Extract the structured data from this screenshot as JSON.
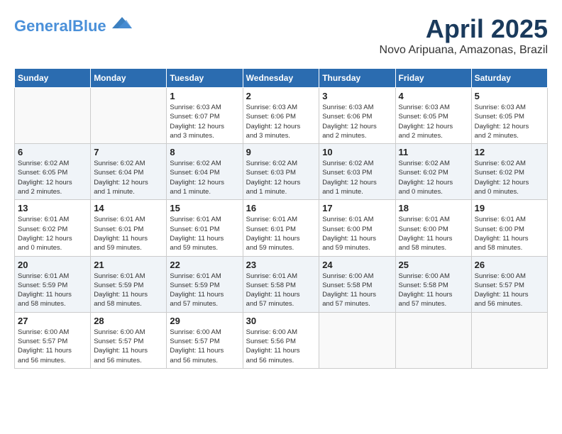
{
  "header": {
    "logo_line1": "General",
    "logo_line2": "Blue",
    "month": "April 2025",
    "location": "Novo Aripuana, Amazonas, Brazil"
  },
  "weekdays": [
    "Sunday",
    "Monday",
    "Tuesday",
    "Wednesday",
    "Thursday",
    "Friday",
    "Saturday"
  ],
  "weeks": [
    [
      {
        "day": "",
        "detail": ""
      },
      {
        "day": "",
        "detail": ""
      },
      {
        "day": "1",
        "detail": "Sunrise: 6:03 AM\nSunset: 6:07 PM\nDaylight: 12 hours\nand 3 minutes."
      },
      {
        "day": "2",
        "detail": "Sunrise: 6:03 AM\nSunset: 6:06 PM\nDaylight: 12 hours\nand 3 minutes."
      },
      {
        "day": "3",
        "detail": "Sunrise: 6:03 AM\nSunset: 6:06 PM\nDaylight: 12 hours\nand 2 minutes."
      },
      {
        "day": "4",
        "detail": "Sunrise: 6:03 AM\nSunset: 6:05 PM\nDaylight: 12 hours\nand 2 minutes."
      },
      {
        "day": "5",
        "detail": "Sunrise: 6:03 AM\nSunset: 6:05 PM\nDaylight: 12 hours\nand 2 minutes."
      }
    ],
    [
      {
        "day": "6",
        "detail": "Sunrise: 6:02 AM\nSunset: 6:05 PM\nDaylight: 12 hours\nand 2 minutes."
      },
      {
        "day": "7",
        "detail": "Sunrise: 6:02 AM\nSunset: 6:04 PM\nDaylight: 12 hours\nand 1 minute."
      },
      {
        "day": "8",
        "detail": "Sunrise: 6:02 AM\nSunset: 6:04 PM\nDaylight: 12 hours\nand 1 minute."
      },
      {
        "day": "9",
        "detail": "Sunrise: 6:02 AM\nSunset: 6:03 PM\nDaylight: 12 hours\nand 1 minute."
      },
      {
        "day": "10",
        "detail": "Sunrise: 6:02 AM\nSunset: 6:03 PM\nDaylight: 12 hours\nand 1 minute."
      },
      {
        "day": "11",
        "detail": "Sunrise: 6:02 AM\nSunset: 6:02 PM\nDaylight: 12 hours\nand 0 minutes."
      },
      {
        "day": "12",
        "detail": "Sunrise: 6:02 AM\nSunset: 6:02 PM\nDaylight: 12 hours\nand 0 minutes."
      }
    ],
    [
      {
        "day": "13",
        "detail": "Sunrise: 6:01 AM\nSunset: 6:02 PM\nDaylight: 12 hours\nand 0 minutes."
      },
      {
        "day": "14",
        "detail": "Sunrise: 6:01 AM\nSunset: 6:01 PM\nDaylight: 11 hours\nand 59 minutes."
      },
      {
        "day": "15",
        "detail": "Sunrise: 6:01 AM\nSunset: 6:01 PM\nDaylight: 11 hours\nand 59 minutes."
      },
      {
        "day": "16",
        "detail": "Sunrise: 6:01 AM\nSunset: 6:01 PM\nDaylight: 11 hours\nand 59 minutes."
      },
      {
        "day": "17",
        "detail": "Sunrise: 6:01 AM\nSunset: 6:00 PM\nDaylight: 11 hours\nand 59 minutes."
      },
      {
        "day": "18",
        "detail": "Sunrise: 6:01 AM\nSunset: 6:00 PM\nDaylight: 11 hours\nand 58 minutes."
      },
      {
        "day": "19",
        "detail": "Sunrise: 6:01 AM\nSunset: 6:00 PM\nDaylight: 11 hours\nand 58 minutes."
      }
    ],
    [
      {
        "day": "20",
        "detail": "Sunrise: 6:01 AM\nSunset: 5:59 PM\nDaylight: 11 hours\nand 58 minutes."
      },
      {
        "day": "21",
        "detail": "Sunrise: 6:01 AM\nSunset: 5:59 PM\nDaylight: 11 hours\nand 58 minutes."
      },
      {
        "day": "22",
        "detail": "Sunrise: 6:01 AM\nSunset: 5:59 PM\nDaylight: 11 hours\nand 57 minutes."
      },
      {
        "day": "23",
        "detail": "Sunrise: 6:01 AM\nSunset: 5:58 PM\nDaylight: 11 hours\nand 57 minutes."
      },
      {
        "day": "24",
        "detail": "Sunrise: 6:00 AM\nSunset: 5:58 PM\nDaylight: 11 hours\nand 57 minutes."
      },
      {
        "day": "25",
        "detail": "Sunrise: 6:00 AM\nSunset: 5:58 PM\nDaylight: 11 hours\nand 57 minutes."
      },
      {
        "day": "26",
        "detail": "Sunrise: 6:00 AM\nSunset: 5:57 PM\nDaylight: 11 hours\nand 56 minutes."
      }
    ],
    [
      {
        "day": "27",
        "detail": "Sunrise: 6:00 AM\nSunset: 5:57 PM\nDaylight: 11 hours\nand 56 minutes."
      },
      {
        "day": "28",
        "detail": "Sunrise: 6:00 AM\nSunset: 5:57 PM\nDaylight: 11 hours\nand 56 minutes."
      },
      {
        "day": "29",
        "detail": "Sunrise: 6:00 AM\nSunset: 5:57 PM\nDaylight: 11 hours\nand 56 minutes."
      },
      {
        "day": "30",
        "detail": "Sunrise: 6:00 AM\nSunset: 5:56 PM\nDaylight: 11 hours\nand 56 minutes."
      },
      {
        "day": "",
        "detail": ""
      },
      {
        "day": "",
        "detail": ""
      },
      {
        "day": "",
        "detail": ""
      }
    ]
  ]
}
